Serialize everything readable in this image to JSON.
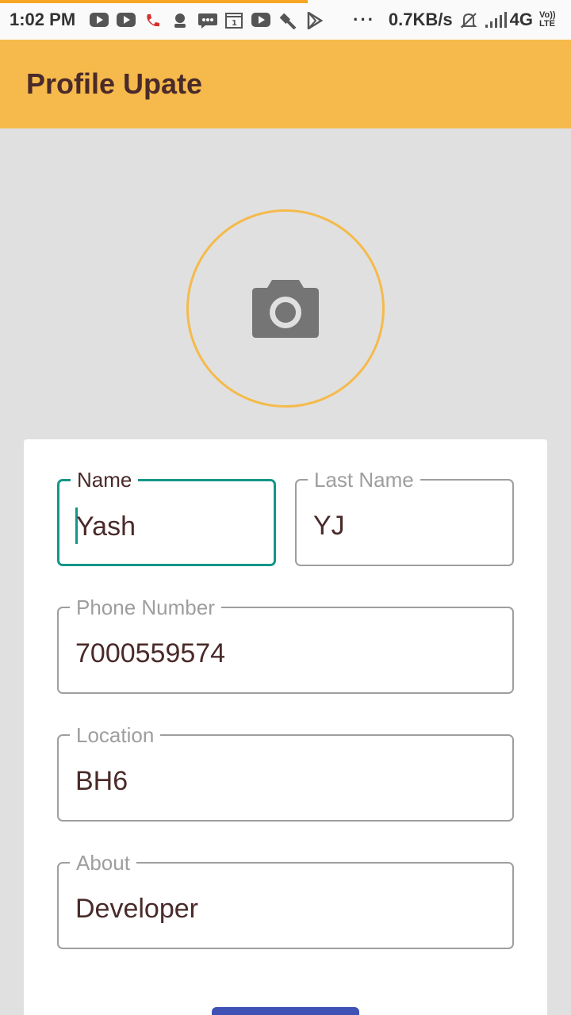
{
  "status_bar": {
    "time": "1:02 PM",
    "more": "···",
    "network_speed": "0.7KB/s",
    "network_type": "4G",
    "volte": "Vo)) LTE"
  },
  "app_bar": {
    "title": "Profile Upate"
  },
  "avatar": {
    "icon": "camera-icon"
  },
  "form": {
    "name": {
      "label": "Name",
      "value": "Yash"
    },
    "last_name": {
      "label": "Last Name",
      "value": "YJ"
    },
    "phone": {
      "label": "Phone Number",
      "value": "7000559574"
    },
    "location": {
      "label": "Location",
      "value": "BH6"
    },
    "about": {
      "label": "About",
      "value": "Developer"
    }
  },
  "colors": {
    "accent": "#f5ba4b",
    "focus": "#159688",
    "button": "#3f51b5"
  }
}
